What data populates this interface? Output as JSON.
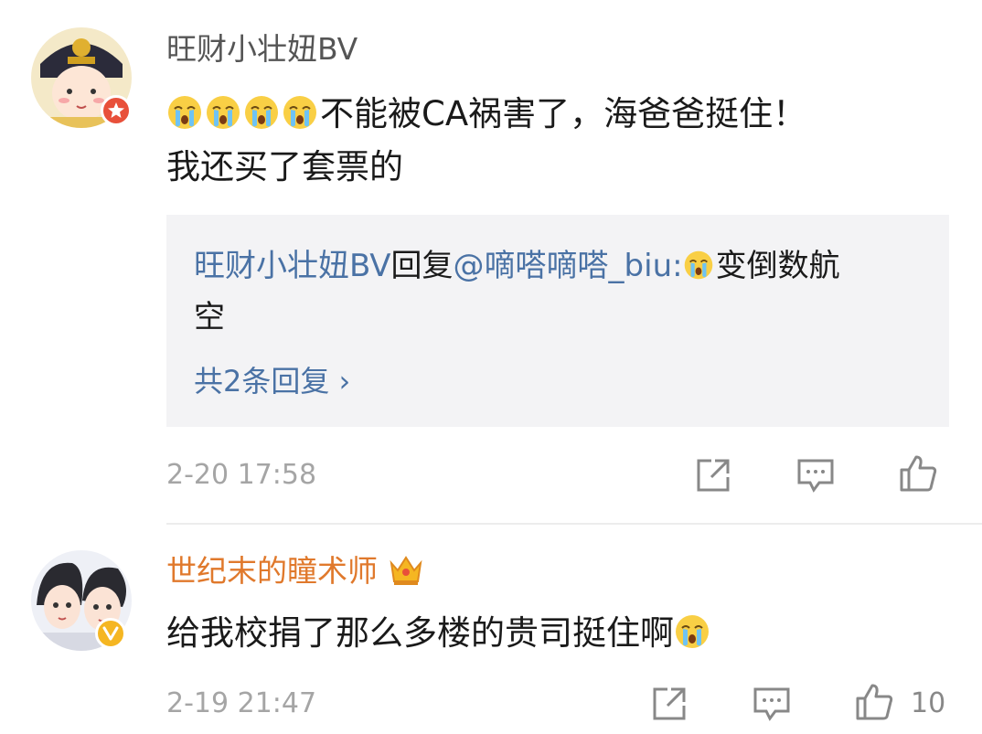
{
  "comments": [
    {
      "username": "旺财小壮妞BV",
      "text_line1": "不能被CA祸害了，海爸爸挺住！",
      "text_line2": "我还买了套票的",
      "reply": {
        "author": "旺财小壮妞BV",
        "verb": "回复",
        "mention": "@嘀嗒嘀嗒_biu:",
        "text_part1": "变倒数航",
        "text_part2": "空",
        "more_link": "共2条回复 ›"
      },
      "timestamp": "2-20 17:58",
      "like_count": ""
    },
    {
      "username": "世纪末的瞳术师",
      "text": "给我校捐了那么多楼的贵司挺住啊",
      "timestamp": "2-19 21:47",
      "like_count": "10"
    }
  ],
  "colors": {
    "link": "#4a72a5",
    "vip_username": "#e0792c",
    "timestamp": "#a5a5a5",
    "verified_red": "#e8503a",
    "verified_gold": "#f5b622"
  },
  "icons": [
    "crying-emoji",
    "share-icon",
    "comment-icon",
    "like-icon",
    "crown-icon",
    "verified-badge-icon"
  ]
}
